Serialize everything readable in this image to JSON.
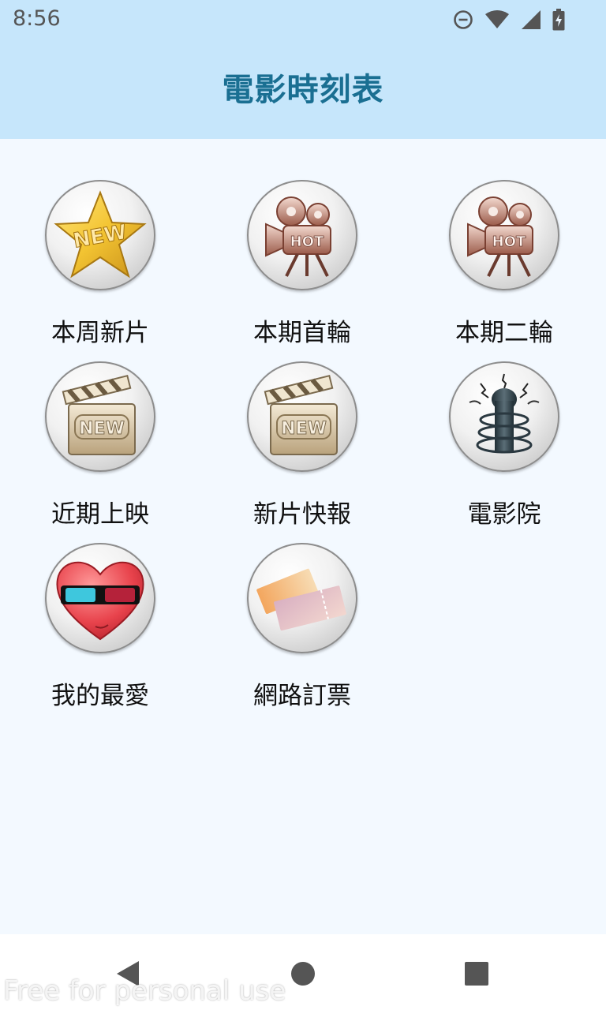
{
  "status_bar": {
    "time": "8:56",
    "icons": [
      "do-not-disturb-icon",
      "wifi-icon",
      "signal-icon",
      "battery-charging-icon"
    ]
  },
  "app_bar": {
    "title": "電影時刻表"
  },
  "menu": {
    "items": [
      {
        "label": "本周新片",
        "icon": "new-star-icon"
      },
      {
        "label": "本期首輪",
        "icon": "hot-camera-icon"
      },
      {
        "label": "本期二輪",
        "icon": "hot-camera-icon"
      },
      {
        "label": "近期上映",
        "icon": "new-clapperboard-icon"
      },
      {
        "label": "新片快報",
        "icon": "new-clapperboard-icon"
      },
      {
        "label": "電影院",
        "icon": "cinema-speaker-icon"
      },
      {
        "label": "我的最愛",
        "icon": "heart-3d-glasses-icon"
      },
      {
        "label": "網路訂票",
        "icon": "tickets-icon"
      }
    ]
  },
  "badge_texts": {
    "new": "NEW",
    "hot": "HOT"
  },
  "nav_bar": {
    "icons": [
      "back-icon",
      "home-icon",
      "recents-icon"
    ]
  },
  "watermark": "Free for personal use",
  "colors": {
    "app_bar": "#c6e6fb",
    "title": "#1a6f92",
    "background": "#f3f9ff"
  }
}
